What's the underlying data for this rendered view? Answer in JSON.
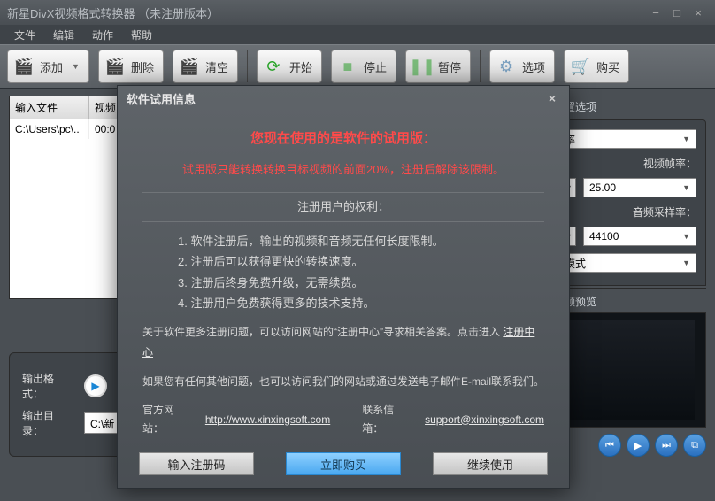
{
  "window_title": "新星DivX视频格式转换器 （未注册版本）",
  "menu": [
    "文件",
    "编辑",
    "动作",
    "帮助"
  ],
  "toolbar": {
    "add": "添加",
    "delete": "删除",
    "clear": "清空",
    "start": "开始",
    "stop": "停止",
    "pause": "暂停",
    "options": "选项",
    "buy": "购买"
  },
  "filelist": {
    "headers": {
      "col1": "输入文件",
      "col2": "视频"
    },
    "rows": [
      {
        "path": "C:\\Users\\pc\\..",
        "dur": "00:0"
      }
    ]
  },
  "output": {
    "format_label": "输出格式：",
    "format_value": "",
    "dir_label": "输出目录：",
    "dir_value": "C:\\新"
  },
  "right": {
    "preset_header": "预置选项",
    "bitrate_label": "率",
    "framerate_label": "视频帧率：",
    "framerate_value": "25.00",
    "samplerate_label": "音频采样率：",
    "samplerate_value": "44100",
    "mode_label": "模式",
    "preview_header": "视频预览"
  },
  "modal": {
    "title": "软件试用信息",
    "warn1": "您现在使用的是软件的试用版：",
    "warn2": "试用版只能转换转换目标视频的前面20%，注册后解除该限制。",
    "benefits_header": "注册用户的权利：",
    "benefits": [
      "软件注册后，输出的视频和音频无任何长度限制。",
      "注册后可以获得更快的转换速度。",
      "注册后终身免费升级，无需续费。",
      "注册用户免费获得更多的技术支持。"
    ],
    "para1_a": "关于软件更多注册问题，可以访问网站的“注册中心”寻求相关答案。点击进入 ",
    "para1_link": "注册中心",
    "para2": "如果您有任何其他问题，也可以访问我们的网站或通过发送电子邮件E-mail联系我们。",
    "site_label": "官方网站：",
    "site_url": "http://www.xinxingsoft.com",
    "mail_label": "联系信箱：",
    "mail_url": "support@xinxingsoft.com",
    "btn_reg": "输入注册码",
    "btn_buy": "立即购买",
    "btn_cont": "继续使用"
  }
}
